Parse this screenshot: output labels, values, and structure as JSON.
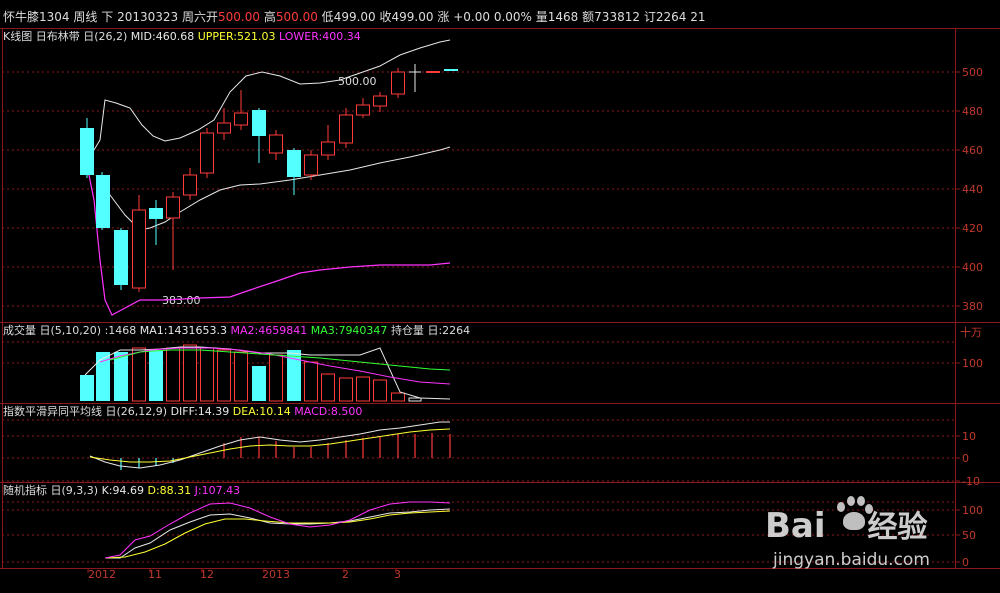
{
  "header": {
    "contract": "怀牛膝1304",
    "period": "周线",
    "direction": "下",
    "date": "20130323",
    "weekday": "周六",
    "open_label": "开",
    "open_value": "500.00",
    "high_label": "高",
    "high_value": "500.00",
    "low_label": "低",
    "low_value": "499.00",
    "close_label": "收",
    "close_value": "499.00",
    "change_label": "涨",
    "change_value": "+0.00",
    "change_pct": "0.00%",
    "volume_label": "量",
    "volume_value": "1468",
    "amount_label": "额",
    "amount_value": "733812",
    "order_label": "订",
    "order_value": "2264",
    "order_extra": "21"
  },
  "kline": {
    "title": "K线图",
    "indicator": "布林带",
    "params": "(26,2)",
    "mid": "MID:460.68",
    "upper": "UPPER:521.03",
    "lower": "LOWER:400.34",
    "high_annot": "500.00",
    "low_annot": "383.00",
    "axis": [
      "500",
      "480",
      "460",
      "440",
      "420",
      "400",
      "380"
    ]
  },
  "volume": {
    "title": "成交量",
    "params": "(5,10,20)",
    "value": ":1468",
    "ma1": "MA1:1431653.3",
    "ma2": "MA2:4659841",
    "ma3": "MA3:7940347",
    "oi_label": "持仓量",
    "oi_value": ":2264",
    "unit": "十万",
    "axis": [
      "100"
    ]
  },
  "macd": {
    "title": "指数平滑异同平均线",
    "params": "(26,12,9)",
    "diff": "DIFF:14.39",
    "dea": "DEA:10.14",
    "macd": "MACD:8.500",
    "axis": [
      "10",
      "0",
      "-10"
    ]
  },
  "kdj": {
    "title": "随机指标",
    "params": "(9,3,3)",
    "k": "K:94.69",
    "d": "D:88.31",
    "j": "J:107.43",
    "axis": [
      "100",
      "50",
      "0"
    ]
  },
  "xaxis": [
    "2012",
    "11",
    "12",
    "2013",
    "2",
    "3"
  ],
  "watermark": {
    "brand": "Bai",
    "brand2": "经验",
    "url": "jingyan.baidu.com"
  },
  "colors": {
    "up": "#ff3b3b",
    "down": "#54ffff",
    "white": "#e8e8e8",
    "yellow": "#ffff33",
    "magenta": "#ff33ff",
    "green": "#33ff33",
    "grid": "#8a1a1a",
    "axis_text": "#c0392b"
  }
}
